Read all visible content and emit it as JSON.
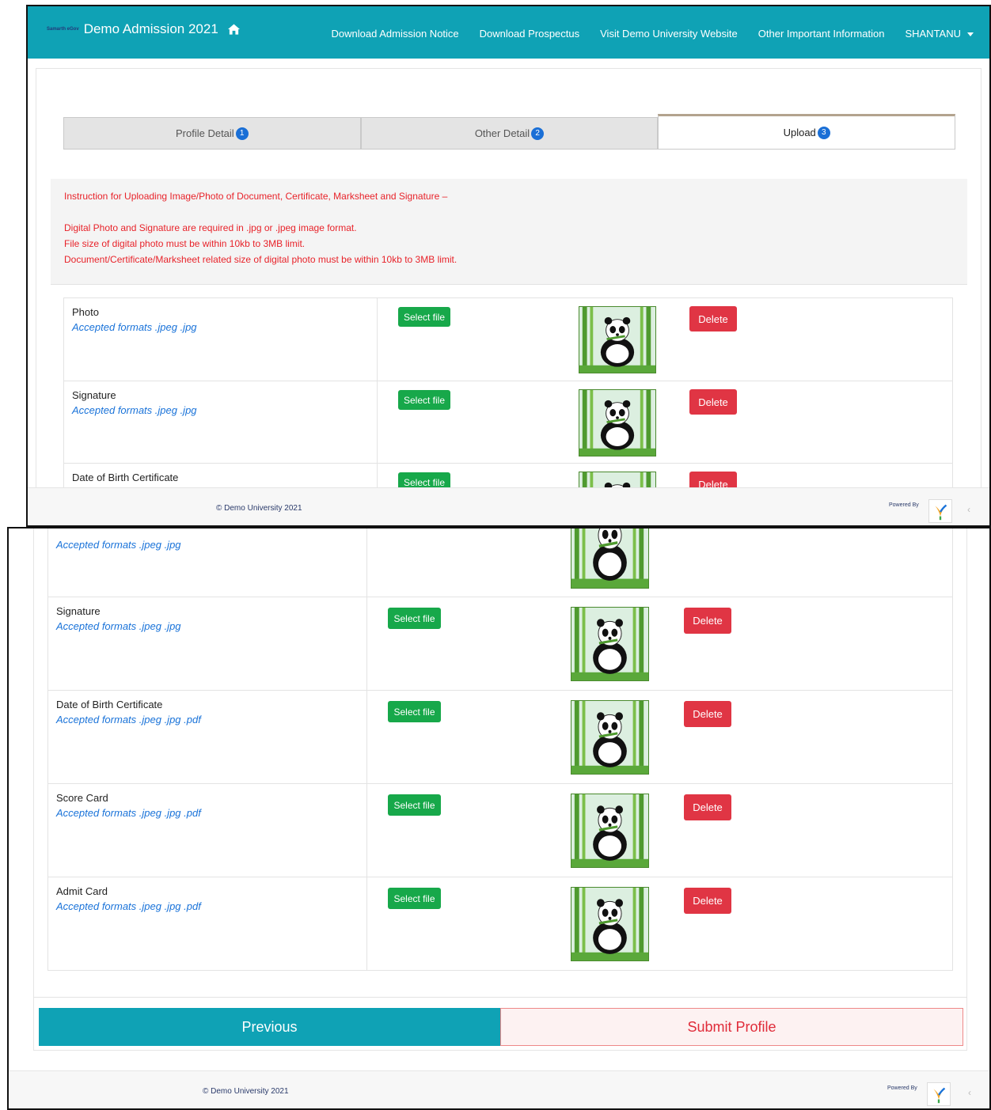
{
  "navbar": {
    "brand_logo": "Samarth eGov",
    "title": "Demo Admission 2021",
    "links": [
      "Download Admission Notice",
      "Download Prospectus",
      "Visit Demo University Website",
      "Other Important Information"
    ],
    "user": "SHANTANU"
  },
  "tabs": [
    {
      "label": "Profile Detail",
      "badge": "1"
    },
    {
      "label": "Other Detail",
      "badge": "2"
    },
    {
      "label": "Upload",
      "badge": "3"
    }
  ],
  "instructions": {
    "heading": "Instruction for Uploading Image/Photo of Document, Certificate, Marksheet and Signature –",
    "lines": [
      "Digital Photo and Signature are required in .jpg or .jpeg image format.",
      "File size of digital photo must be within 10kb to 3MB limit.",
      "Document/Certificate/Marksheet related size of digital photo must be within 10kb to 3MB limit."
    ]
  },
  "documents": [
    {
      "name": "Photo",
      "formats": "Accepted formats .jpeg .jpg"
    },
    {
      "name": "Signature",
      "formats": "Accepted formats .jpeg .jpg"
    },
    {
      "name": "Date of Birth Certificate",
      "formats": "Accepted formats .jpeg .jpg .pdf"
    },
    {
      "name": "Score Card",
      "formats": "Accepted formats .jpeg .jpg .pdf"
    },
    {
      "name": "Admit Card",
      "formats": "Accepted formats .jpeg .jpg .pdf"
    }
  ],
  "buttons": {
    "select_file": "Select file",
    "delete": "Delete",
    "previous": "Previous",
    "submit": "Submit Profile"
  },
  "footer": {
    "copyright": "© Demo University 2021",
    "powered_by": "Powered By"
  },
  "colors": {
    "primary": "#0fa2b5",
    "select": "#17a84a",
    "delete": "#e03544",
    "instruction_text": "#e8232a",
    "formats_text": "#1a73d9"
  }
}
